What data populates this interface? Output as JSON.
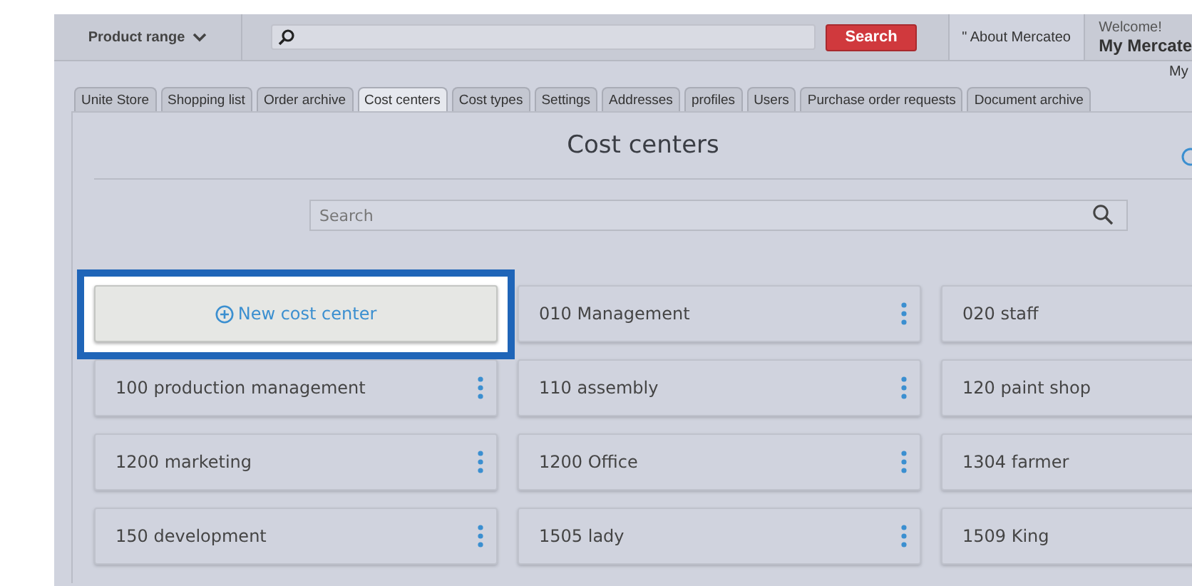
{
  "topbar": {
    "product_range": "Product range",
    "search_button": "Search",
    "about": "\" About Mercateo",
    "welcome": "Welcome!",
    "account": "My Mercate"
  },
  "my_link": "My",
  "tabs": [
    {
      "label": "Unite Store",
      "selected": false
    },
    {
      "label": "Shopping list",
      "selected": false
    },
    {
      "label": "Order archive",
      "selected": false
    },
    {
      "label": "Cost centers",
      "selected": true
    },
    {
      "label": "Cost types",
      "selected": false
    },
    {
      "label": "Settings",
      "selected": false
    },
    {
      "label": "Addresses",
      "selected": false
    },
    {
      "label": "profiles",
      "selected": false
    },
    {
      "label": "Users",
      "selected": false
    },
    {
      "label": "Purchase order requests",
      "selected": false
    },
    {
      "label": "Document archive",
      "selected": false
    }
  ],
  "title": "Cost centers",
  "search": {
    "placeholder": "Search"
  },
  "new_button": {
    "label": "New cost center",
    "highlighted": true
  },
  "cost_centers": [
    {
      "name": "010 Management"
    },
    {
      "name": "020 staff"
    },
    {
      "name": "100 production management"
    },
    {
      "name": "110 assembly"
    },
    {
      "name": "120 paint shop"
    },
    {
      "name": "1200 marketing"
    },
    {
      "name": "1200 Office"
    },
    {
      "name": "1304 farmer"
    },
    {
      "name": "150 development"
    },
    {
      "name": "1505 lady"
    },
    {
      "name": "1509 King"
    }
  ]
}
